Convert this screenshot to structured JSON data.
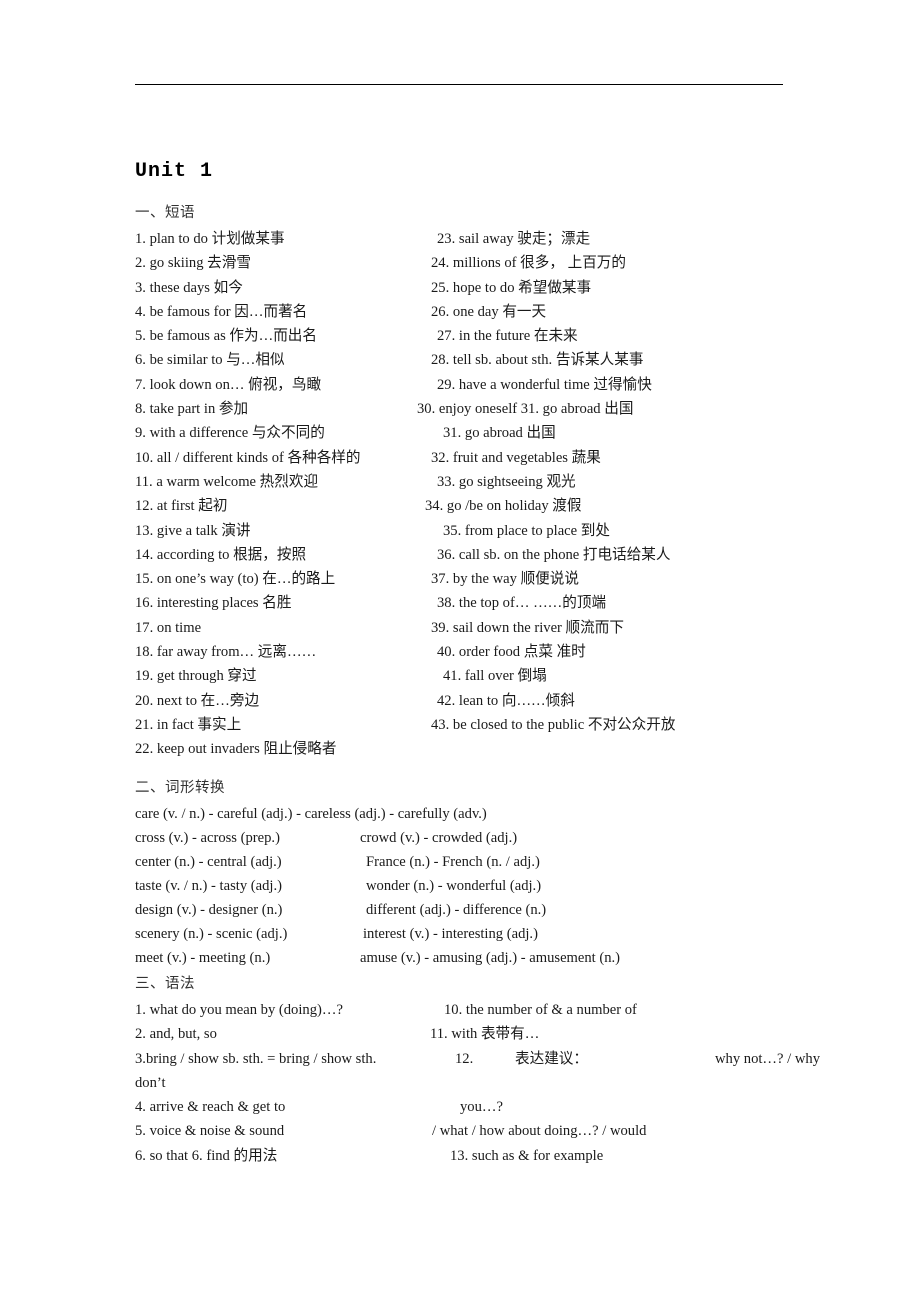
{
  "document": {
    "unit_title": "Unit 1",
    "sections": {
      "phrases_heading": "一、短语",
      "wordform_heading": "二、词形转换",
      "grammar_heading": "三、语法"
    }
  },
  "phrases": {
    "left": [
      "1. plan to do  计划做某事",
      "2. go skiing  去滑雪",
      "3. these days  如今",
      "4. be famous for  因…而著名",
      "5. be famous as  作为…而出名",
      "6. be similar to  与…相似",
      "7. look down on…  俯视，鸟瞰",
      "8. take part in  参加",
      "9. with a difference  与众不同的",
      "10. all / different kinds of  各种各样的",
      "11. a warm welcome  热烈欢迎",
      "12. at first  起初",
      "13. give a talk  演讲",
      "14. according to  根据，按照",
      "15. on one’s way (to)  在…的路上",
      "16. interesting places  名胜",
      "17. on time",
      "18. far away from…  远离……",
      "19. get through  穿过",
      "20. next to  在…旁边",
      "21. in fact  事实上",
      "22. keep out invaders  阻止侵略者"
    ],
    "right": [
      "23. sail away  驶走；漂走",
      "24. millions of  很多， 上百万的",
      "25. hope to do  希望做某事",
      "26. one day  有一天",
      "27. in the future  在未来",
      "28. tell sb. about sth.  告诉某人某事",
      "29. have a wonderful time  过得愉快",
      "30. enjoy oneself 31. go abroad  出国",
      "31. go abroad  出国",
      "32. fruit and vegetables  蔬果",
      "33. go sightseeing  观光",
      "34. go /be on holiday  渡假",
      "35. from place to place  到处",
      "36. call sb. on the phone  打电话给某人",
      "37. by the way  顺便说说",
      "38. the top of…  ……的顶端",
      "39. sail down the river  顺流而下",
      "40. order food  点菜  准时",
      "41. fall over  倒塌",
      "42. lean to  向……倾斜",
      "43. be closed to the public  不对公众开放"
    ],
    "right_indent": [
      1,
      0,
      0,
      0,
      1,
      0,
      1,
      -1,
      2,
      0,
      1,
      0,
      2,
      1,
      0,
      1,
      0,
      1,
      2,
      1,
      0
    ]
  },
  "wordform": {
    "full_width_row": "care (v. / n.) - careful (adj.) - careless (adj.) - carefully (adv.)",
    "rows": [
      {
        "a": "cross (v.) - across (prep.)",
        "b": "crowd (v.) - crowded (adj.)"
      },
      {
        "a": "center (n.) - central (adj.)",
        "b": "France (n.) - French (n. / adj.)"
      },
      {
        "a": "taste (v. / n.) - tasty (adj.)",
        "b": "wonder (n.) - wonderful (adj.)"
      },
      {
        "a": "design (v.) - designer (n.)",
        "b": "different (adj.) - difference (n.)"
      },
      {
        "a": "scenery (n.) - scenic (adj.)",
        "b": "interest (v.) - interesting (adj.)"
      },
      {
        "a": "meet (v.) - meeting (n.)",
        "b": "amuse (v.) - amusing (adj.) - amusement (n.)"
      }
    ]
  },
  "grammar": {
    "left": [
      "1. what do you mean by (doing)…?",
      "2. and, but, so",
      "3.bring / show sb. sth. = bring / show sth.",
      "don’t",
      "4. arrive & reach & get to",
      "5. voice & noise & sound",
      "6. so that 6. find  的用法"
    ],
    "right": {
      "item10": "10. the number of & a number of",
      "item11": "11. with  表带有…",
      "item12_num": "12.",
      "item12_cn": "表达建议：",
      "item12_tail": "why not…? / why",
      "item12_line2": "you…?",
      "item12_line3": "/ what / how about doing…? / would",
      "item13": "13. such as & for example"
    }
  }
}
